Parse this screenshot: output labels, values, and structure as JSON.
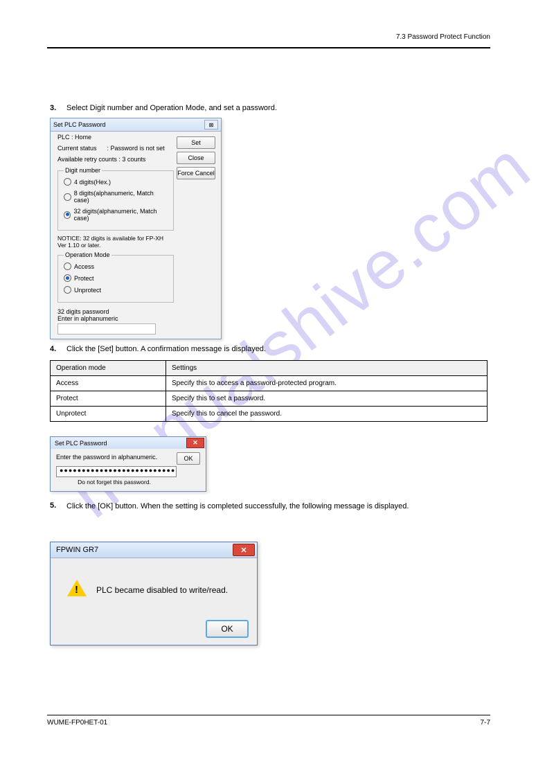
{
  "header": {
    "right": "7.3 Password Protect Function"
  },
  "step3": {
    "num": "3.",
    "text": "Select Digit number and Operation Mode, and set a password."
  },
  "dlg1": {
    "title": "Set PLC Password",
    "close_glyph": "⊠",
    "plc_label": "PLC  :",
    "plc_value": "Home",
    "status_label": "Current status",
    "status_value": ":  Password is not set",
    "retry_label": "Available retry counts",
    "retry_value": ":  3 counts",
    "fs_digit": "Digit number",
    "r_4": "4 digits(Hex.)",
    "r_8": "8 digits(alphanumeric, Match case)",
    "r_32": "32 digits(alphanumeric, Match case)",
    "notice": "NOTICE: 32 digits is available for FP-XH Ver 1.10 or later.",
    "fs_mode": "Operation Mode",
    "r_access": "Access",
    "r_protect": "Protect",
    "r_unprotect": "Unprotect",
    "pwd_label1": "32 digits password",
    "pwd_label2": "Enter in alphanumeric",
    "btn_set": "Set",
    "btn_close": "Close",
    "btn_force": "Force Cancel"
  },
  "step4": {
    "num": "4.",
    "text": "Click the [Set] button. A confirmation message is displayed."
  },
  "table": {
    "h1": "Operation mode",
    "h2": "Settings",
    "rows": [
      [
        "Access",
        "Specify this to access a password-protected program."
      ],
      [
        "Protect",
        "Specify this to set a password."
      ],
      [
        "Unprotect",
        "Specify this to cancel the password."
      ]
    ]
  },
  "dlg2": {
    "title": "Set PLC Password",
    "prompt": "Enter the password in alphanumeric.",
    "ok": "OK",
    "mask": "●●●●●●●●●●●●●●●●●●●●●●●●●●●●",
    "warn": "Do not forget this password."
  },
  "step5": {
    "num": "5.",
    "text": "Click the [OK] button. When the setting is completed successfully, the following message is displayed."
  },
  "dlg3": {
    "title": "FPWIN GR7",
    "msg": "PLC became disabled to write/read.",
    "ok": "OK"
  },
  "footer": {
    "left": "WUME-FP0HET-01",
    "right": "7-7"
  }
}
